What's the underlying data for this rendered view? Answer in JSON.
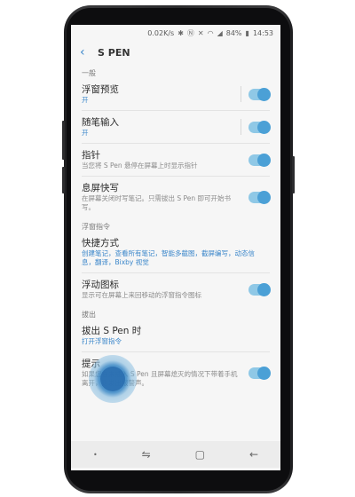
{
  "status": {
    "speed": "0.02K/s",
    "battery": "84%",
    "time": "14:53"
  },
  "appbar": {
    "title": "S PEN"
  },
  "sections": {
    "general": "一般",
    "air_command": "浮窗指令",
    "detach": "拔出"
  },
  "rows": {
    "air_view": {
      "label": "浮窗预览",
      "sub": "开"
    },
    "direct_pen_input": {
      "label": "随笔输入",
      "sub": "开"
    },
    "pointer": {
      "label": "指针",
      "sub": "当您将 S Pen 悬停在屏幕上时显示指针"
    },
    "screen_off_memo": {
      "label": "息屏快写",
      "sub": "在屏幕关闭时写笔记。只需拔出 S Pen 即可开始书写。"
    },
    "shortcuts": {
      "label": "快捷方式",
      "sub": "创建笔记，查看所有笔记，智能多截图，截屏编写，动态信息，翻译，Bixby 视觉"
    },
    "floating_icon": {
      "label": "浮动图标",
      "sub": "显示可在屏幕上来回移动的浮窗指令图标"
    },
    "when_detached": {
      "label": "拔出 S Pen 时",
      "sub": "打开浮窗指令"
    },
    "alarm": {
      "label": "提示",
      "sub": "如果您在未插入 S Pen 且屏幕熄灭的情况下带着手机离开，则发出报警声。"
    }
  },
  "toggles": {
    "air_view": true,
    "direct_pen_input": true,
    "pointer": true,
    "screen_off_memo": true,
    "floating_icon": true,
    "alarm": true
  },
  "icons": [
    "back-icon",
    "bluetooth-icon",
    "nfc-icon",
    "mute-icon",
    "wifi-icon",
    "signal-icon",
    "battery-icon",
    "recents-icon",
    "home-icon",
    "nav-back-icon"
  ],
  "colors": {
    "accent": "#3a86ca",
    "toggle": "#4ba0d6"
  }
}
